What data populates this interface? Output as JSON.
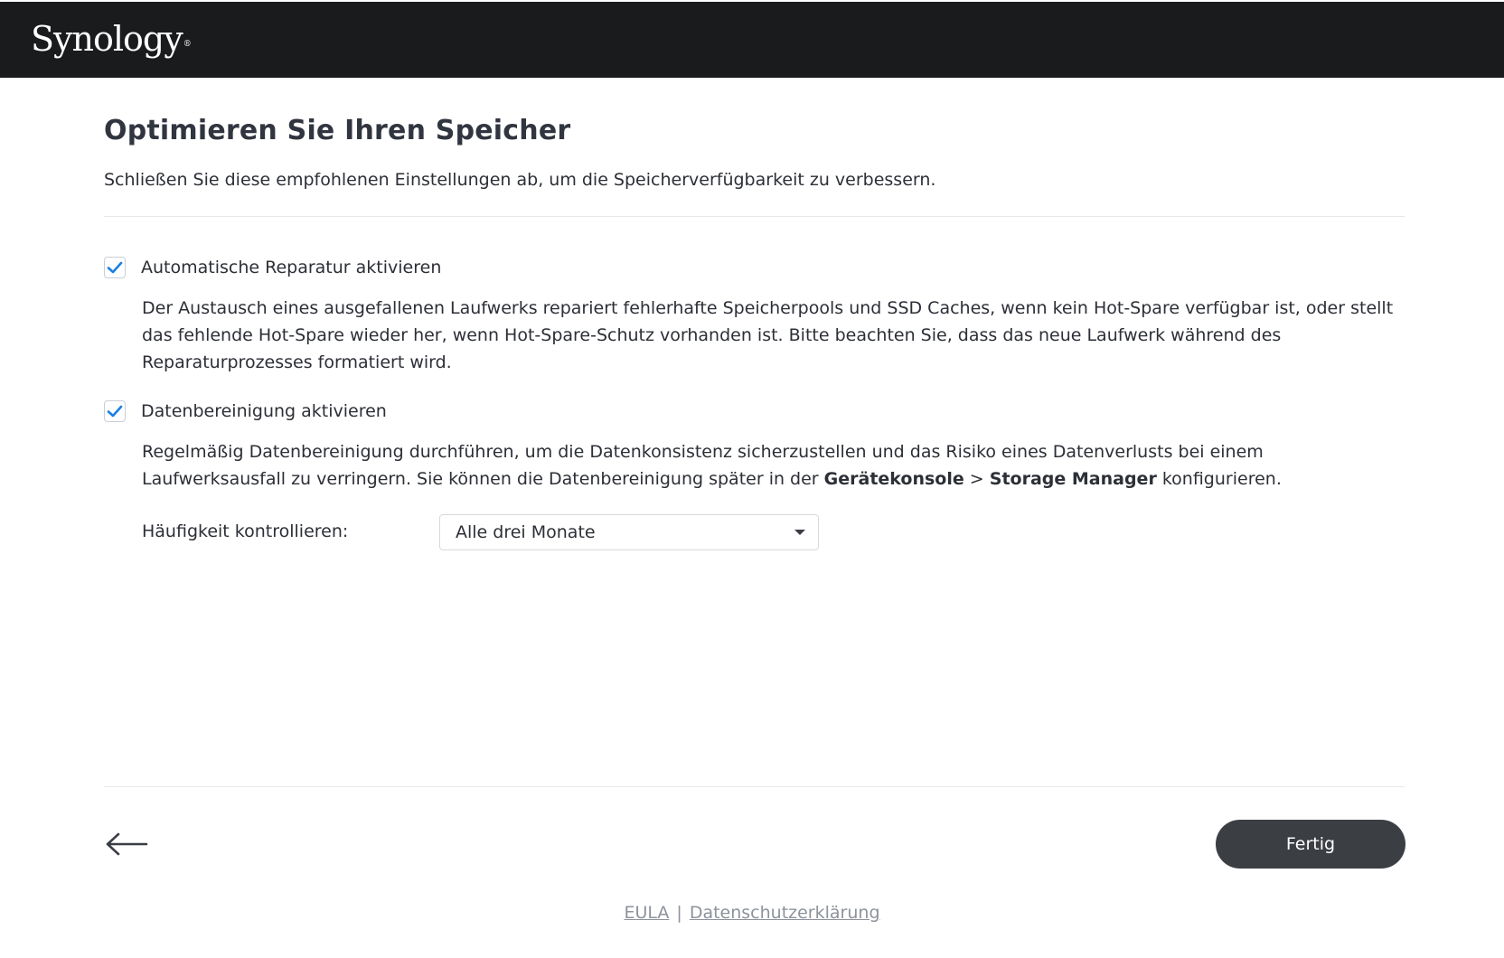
{
  "header": {
    "logo_text": "Synology",
    "logo_mark": "®"
  },
  "main": {
    "title": "Optimieren Sie Ihren Speicher",
    "subtitle": "Schließen Sie diese empfohlenen Einstellungen ab, um die Speicherverfügbarkeit zu verbessern.",
    "auto_repair": {
      "checked": true,
      "label": "Automatische Reparatur aktivieren",
      "description": "Der Austausch eines ausgefallenen Laufwerks repariert fehlerhafte Speicherpools und SSD Caches, wenn kein Hot-Spare verfügbar ist, oder stellt das fehlende Hot-Spare wieder her, wenn Hot-Spare-Schutz vorhanden ist. Bitte beachten Sie, dass das neue Laufwerk während des Reparaturprozesses formatiert wird."
    },
    "data_scrubbing": {
      "checked": true,
      "label": "Datenbereinigung aktivieren",
      "description_before": "Regelmäßig Datenbereinigung durchführen, um die Datenkonsistenz sicherzustellen und das Risiko eines Datenverlusts bei einem Laufwerksausfall zu verringern. Sie können die Datenbereinigung später in der ",
      "description_bold1": "Gerätekonsole",
      "description_sep": " > ",
      "description_bold2": "Storage Manager",
      "description_after": " konfigurieren.",
      "frequency_label": "Häufigkeit kontrollieren:",
      "frequency_value": "Alle drei Monate"
    }
  },
  "footer_nav": {
    "done_label": "Fertig",
    "back_icon": "arrow-left-icon"
  },
  "footer": {
    "eula": "EULA",
    "separator": "|",
    "privacy": "Datenschutzerklärung"
  },
  "colors": {
    "topbar": "#1a1b1d",
    "checkmark": "#1b7fe3",
    "done_button": "#3b3e43"
  }
}
